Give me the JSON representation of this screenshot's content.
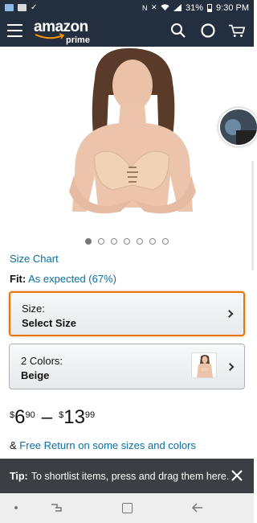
{
  "status_bar": {
    "battery": "31%",
    "time": "9:30 PM",
    "icons": [
      "gallery-icon",
      "image-icon",
      "check-icon",
      "nfc-icon",
      "mute-icon",
      "wifi-icon",
      "signal-icon",
      "battery-icon"
    ]
  },
  "header": {
    "logo_text": "amazon",
    "logo_sub": "prime",
    "icons": [
      "menu-icon",
      "search-icon",
      "alexa-icon",
      "cart-icon"
    ],
    "bg_color": "#232f3e"
  },
  "gallery": {
    "image_count": 7,
    "active_index": 0
  },
  "size_chart": {
    "label": "Size Chart"
  },
  "fit": {
    "label": "Fit:",
    "value": "As expected (67%)"
  },
  "size_selector": {
    "label": "Size:",
    "value": "Select Size"
  },
  "color_selector": {
    "label": "2 Colors:",
    "value": "Beige"
  },
  "price": {
    "low": {
      "symbol": "$",
      "whole": "6",
      "fraction": "90"
    },
    "separator": "–",
    "high": {
      "symbol": "$",
      "whole": "13",
      "fraction": "99"
    }
  },
  "returns": {
    "prefix": "& ",
    "link": "Free Return",
    "suffix": " on some sizes and colors"
  },
  "tip": {
    "label": "Tip:",
    "text": "To shortlist items, press and drag them here."
  },
  "colors": {
    "link": "#0a6e9f",
    "selected_border": "#e77600",
    "tip_bg": "#3b3f43"
  }
}
